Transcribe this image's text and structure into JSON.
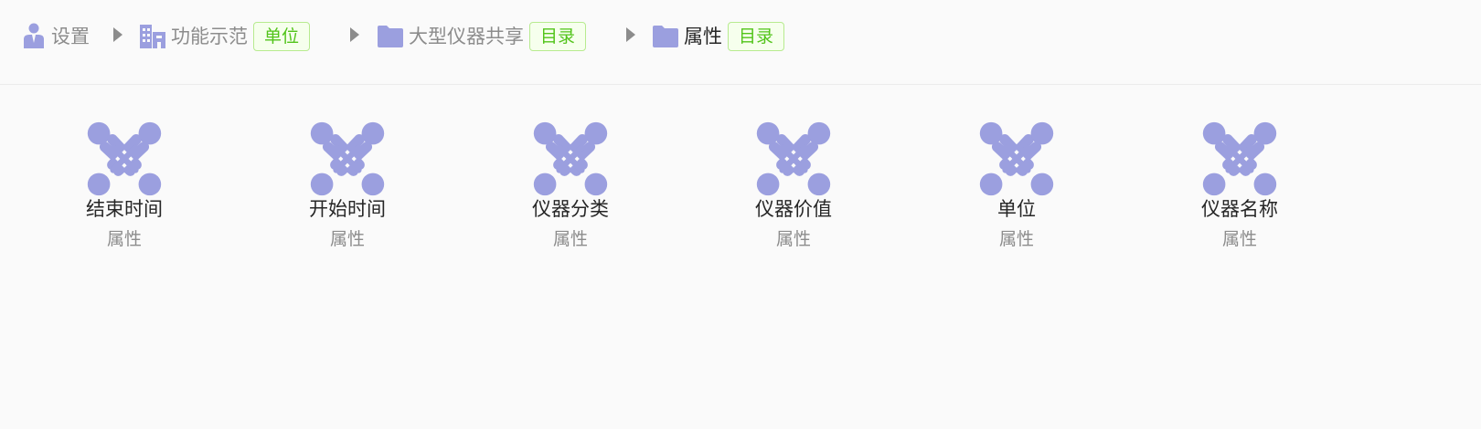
{
  "colors": {
    "icon": "#9b9fdf",
    "tag_text": "#52c41a",
    "tag_border": "#b7eb8f",
    "muted_text": "#8c8c8c",
    "dark_text": "#262626",
    "background": "#fafafa"
  },
  "breadcrumb": {
    "items": [
      {
        "icon": "user-icon",
        "label": "设置",
        "tag": ""
      },
      {
        "icon": "building-icon",
        "label": "功能示范",
        "tag": "单位"
      },
      {
        "icon": "folder-icon",
        "label": "大型仪器共享",
        "tag": "目录"
      },
      {
        "icon": "folder-icon",
        "label": "属性",
        "tag": "目录"
      }
    ],
    "separator_icon": "caret-right-icon"
  },
  "grid": {
    "item_icon": "joomla-icon",
    "items": [
      {
        "name": "结束时间",
        "type": "属性"
      },
      {
        "name": "开始时间",
        "type": "属性"
      },
      {
        "name": "仪器分类",
        "type": "属性"
      },
      {
        "name": "仪器价值",
        "type": "属性"
      },
      {
        "name": "单位",
        "type": "属性"
      },
      {
        "name": "仪器名称",
        "type": "属性"
      }
    ]
  }
}
